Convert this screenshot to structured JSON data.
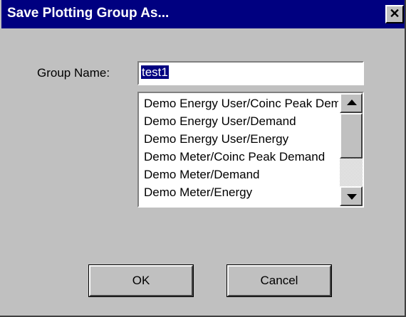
{
  "window": {
    "title": "Save Plotting Group As...",
    "close_label": "✕"
  },
  "form": {
    "group_name_label": "Group Name:",
    "group_name_value": "test1"
  },
  "list": {
    "items": [
      "Demo Energy User/Coinc Peak Demand",
      "Demo Energy User/Demand",
      "Demo Energy User/Energy",
      "Demo Meter/Coinc Peak Demand",
      "Demo Meter/Demand",
      "Demo Meter/Energy"
    ]
  },
  "buttons": {
    "ok_label": "OK",
    "cancel_label": "Cancel"
  },
  "colors": {
    "titlebar": "#000080",
    "dialog_bg": "#c0c0c0",
    "selection": "#000080"
  },
  "icons": {
    "close": "close-icon",
    "scroll_up": "arrow-up-icon",
    "scroll_down": "arrow-down-icon"
  }
}
